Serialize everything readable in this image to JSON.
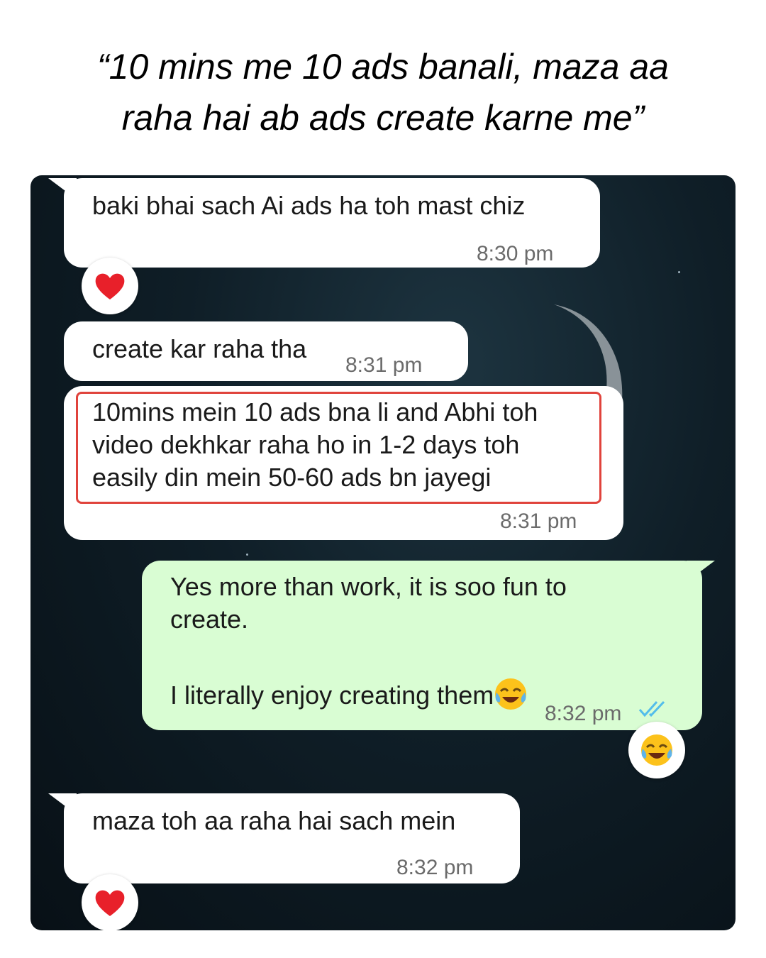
{
  "headline": {
    "line1": "“10 mins me 10 ads banali, maza aa",
    "line2": "raha hai ab ads create karne me”"
  },
  "messages": [
    {
      "direction": "incoming",
      "text": "baki bhai sach Ai ads ha toh mast chiz",
      "time": "8:30 pm",
      "reaction": "heart-icon"
    },
    {
      "direction": "incoming",
      "text": "create kar raha tha",
      "time": "8:31 pm"
    },
    {
      "direction": "incoming",
      "text": "10mins mein 10 ads bna li and Abhi toh\nvideo dekhkar raha ho in 1-2 days toh\neasily din mein 50-60 ads bn jayegi",
      "time": "8:31 pm",
      "highlighted": true
    },
    {
      "direction": "outgoing",
      "text": "Yes more than work, it is soo fun to\ncreate.",
      "text2": "I literally enjoy creating them",
      "time": "8:32 pm",
      "status": "read-double-check-icon",
      "reaction": "tears-of-joy-icon"
    },
    {
      "direction": "incoming",
      "text": "maza toh aa raha hai sach mein",
      "time": "8:32 pm",
      "reaction": "heart-icon"
    }
  ],
  "colors": {
    "incoming_bubble": "#ffffff",
    "outgoing_bubble": "#d9fdd3",
    "highlight_border": "#e0433c",
    "read_ticks": "#53bdeb"
  }
}
